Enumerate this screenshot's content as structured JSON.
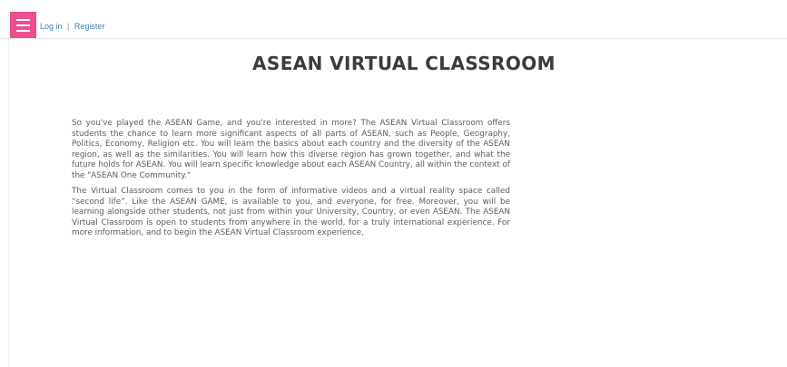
{
  "header": {
    "menu_icon": "hamburger-menu-icon",
    "login_label": "Log in",
    "separator": "|",
    "register_label": "Register"
  },
  "page": {
    "title": "ASEAN VIRTUAL CLASSROOM",
    "paragraphs": [
      "So you've played the ASEAN Game, and you're interested in more? The ASEAN Virtual Classroom offers students the chance to learn more significant aspects of all parts of ASEAN, such as People, Geography, Politics, Economy, Religion etc. You will learn the basics about each country and the diversity of the ASEAN region, as well as the similarities. You will learn how this diverse region has grown together, and what the future holds for ASEAN. You will learn specific knowledge about each ASEAN Country, all within the context of the \"ASEAN One Community.\"",
      "The Virtual Classroom comes to you in the form of informative videos and a virtual reality space called “second life”. Like the ASEAN GAME, is available to you, and everyone, for free. Moreover, you will be learning alongside other students, not just from within your University, Country, or even ASEAN. The ASEAN Virtual Classroom is open to students from anywhere in the world, for a truly international experience. For more information, and to begin the ASEAN Virtual Classroom experience,"
    ]
  },
  "colors": {
    "menu_button": "#ea4f8f",
    "link": "#3d7ab7",
    "title": "#3b3b3b",
    "body_text": "#5b5b5b"
  }
}
